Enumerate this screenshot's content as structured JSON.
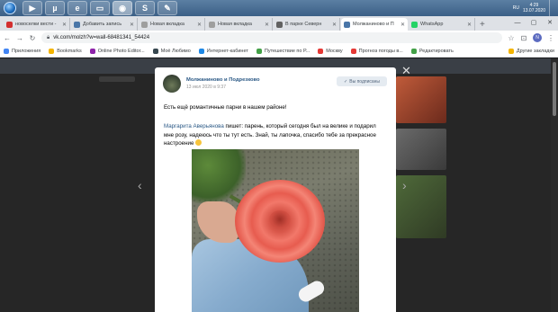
{
  "taskbar": {
    "apps": [
      "start-orb",
      "media-player",
      "utorrent",
      "ie",
      "explorer",
      "chrome",
      "skype",
      "notes"
    ],
    "language": "RU",
    "time": "4:29",
    "date": "13.07.2020"
  },
  "tabs": [
    {
      "title": "новоселки вести -",
      "color": "#d32f2f",
      "active": false
    },
    {
      "title": "Добавить запись",
      "color": "#4a76a8",
      "active": false
    },
    {
      "title": "Новая вкладка",
      "color": "#9e9e9e",
      "active": false
    },
    {
      "title": "Новая вкладка",
      "color": "#9e9e9e",
      "active": false
    },
    {
      "title": "В парке Северн",
      "color": "#616161",
      "active": false
    },
    {
      "title": "Молжаниново и П",
      "color": "#4a76a8",
      "active": true
    },
    {
      "title": "WhatsApp",
      "color": "#25d366",
      "active": false
    }
  ],
  "address": {
    "url": "vk.com/molzh?w=wall-68481341_54424"
  },
  "bookmarks": [
    {
      "label": "Приложения",
      "color": "#4285f4"
    },
    {
      "label": "Bookmarks",
      "color": "#f4b400"
    },
    {
      "label": "Online Photo Editor...",
      "color": "#8e24aa"
    },
    {
      "label": "Моё Любимо",
      "color": "#37474f"
    },
    {
      "label": "Интернет-кабинет",
      "color": "#1e88e5"
    },
    {
      "label": "Путешествие по Р...",
      "color": "#43a047"
    },
    {
      "label": "Москву",
      "color": "#e53935"
    },
    {
      "label": "Прогноз погоды в...",
      "color": "#e53935"
    },
    {
      "label": "Редактировать",
      "color": "#43a047"
    }
  ],
  "bookmarks_other": "Другие закладки",
  "post": {
    "group": "Молжаниново и Подрезково",
    "date": "13 июл 2020 в 9:37",
    "subscribed": "Вы подписаны",
    "intro": "Есть ещё романтичные парни в нашем районе!",
    "author": "Маргарита Аверьянова",
    "body": " пишет: парень, который сегодня был на велике и подарил мне розу, надеюсь что ты тут есть. Знай, ты лапочка, спасибо тебе за прекрасное настроение"
  }
}
